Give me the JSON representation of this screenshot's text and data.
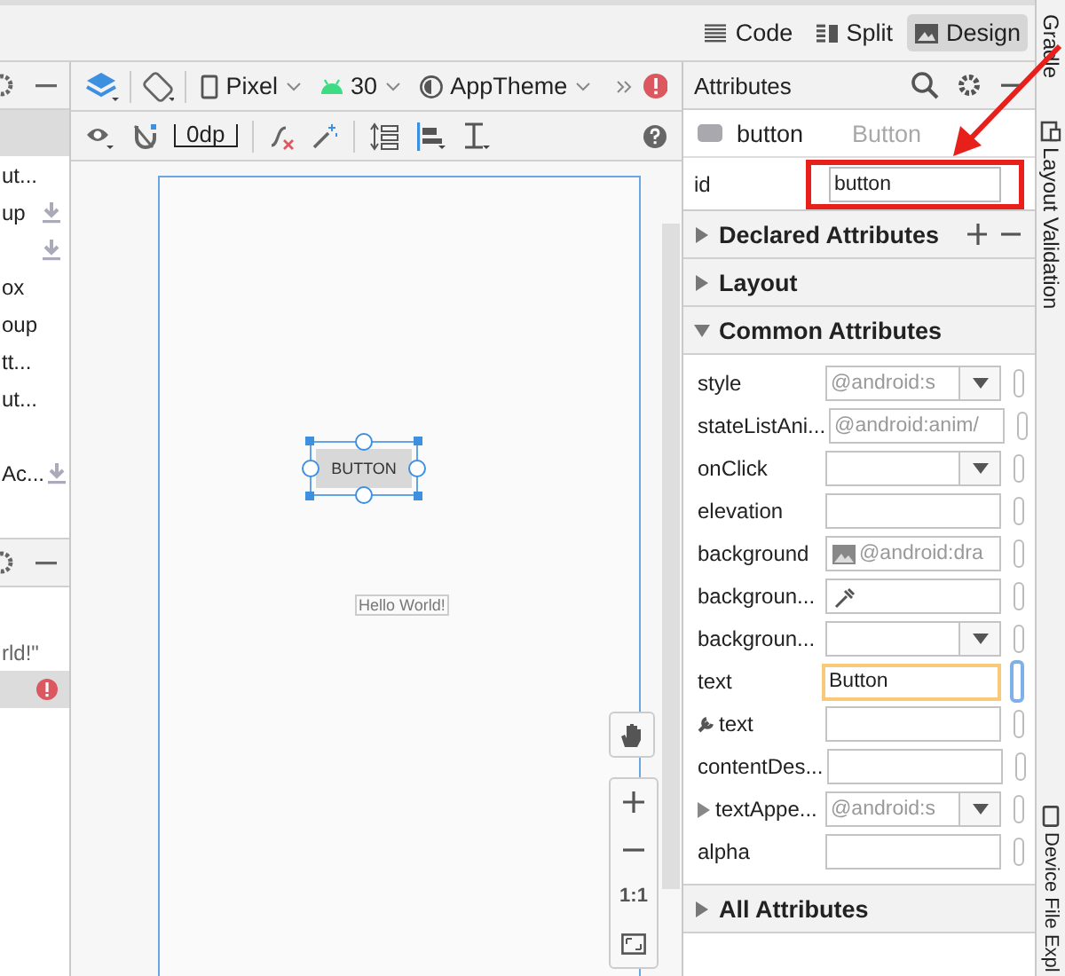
{
  "view_modes": [
    {
      "label": "Code",
      "selected": false
    },
    {
      "label": "Split",
      "selected": false
    },
    {
      "label": "Design",
      "selected": true
    }
  ],
  "palette": {
    "items": [
      {
        "label": "ut...",
        "download": false
      },
      {
        "label": "up",
        "download": true
      },
      {
        "download": true
      },
      {
        "label": "ox",
        "download": false
      },
      {
        "label": "oup",
        "download": false
      },
      {
        "label": "tt...",
        "download": false
      },
      {
        "label": "ut...",
        "download": false
      },
      {
        "download": false
      },
      {
        "label": "Ac...",
        "download": true
      }
    ]
  },
  "component_tree": {
    "items": [
      {
        "label": "rld!\"",
        "selected": false,
        "error": false
      },
      {
        "selected": true,
        "error": true
      }
    ]
  },
  "toolbar": {
    "device": "Pixel",
    "api": "30",
    "theme": "AppTheme",
    "margin": "0dp"
  },
  "canvas": {
    "widget_text": "BUTTON",
    "hello_text": "Hello World!",
    "zoom_reset": "1:1"
  },
  "attributes": {
    "title": "Attributes",
    "component": {
      "name": "button",
      "type": "Button"
    },
    "id": {
      "label": "id",
      "value": "button"
    },
    "sections_before": [
      {
        "label": "Declared Attributes",
        "expanded": false,
        "add_remove": true
      },
      {
        "label": "Layout",
        "expanded": false,
        "add_remove": false
      },
      {
        "label": "Common Attributes",
        "expanded": true,
        "add_remove": false
      }
    ],
    "properties": [
      {
        "label": "style",
        "kind": "dropdown",
        "placeholder": "@android:s",
        "focused": false,
        "tool": false,
        "expandable": false
      },
      {
        "label": "stateListAni...",
        "kind": "text",
        "placeholder": "@android:anim/",
        "focused": false,
        "tool": false,
        "expandable": false
      },
      {
        "label": "onClick",
        "kind": "dropdown",
        "focused": false,
        "tool": false,
        "expandable": false
      },
      {
        "label": "elevation",
        "kind": "text",
        "focused": false,
        "tool": false,
        "expandable": false
      },
      {
        "label": "background",
        "kind": "image",
        "placeholder": "@android:dra",
        "focused": false,
        "tool": false,
        "expandable": false
      },
      {
        "label": "backgroun...",
        "kind": "color",
        "focused": false,
        "tool": false,
        "expandable": false
      },
      {
        "label": "backgroun...",
        "kind": "dropdown",
        "focused": false,
        "tool": false,
        "expandable": false
      },
      {
        "label": "text",
        "kind": "text",
        "value": "Button",
        "focused": true,
        "tool": false,
        "expandable": false
      },
      {
        "label": "text",
        "kind": "text",
        "tool": true,
        "focused": false,
        "expandable": false
      },
      {
        "label": "contentDes...",
        "kind": "text",
        "focused": false,
        "tool": false,
        "expandable": false
      },
      {
        "label": "textAppe...",
        "kind": "dropdown",
        "expandable": true,
        "placeholder": "@android:s",
        "focused": false,
        "tool": false
      },
      {
        "label": "alpha",
        "kind": "text",
        "focused": false,
        "tool": false,
        "expandable": false
      }
    ],
    "sections_after": [
      {
        "label": "All Attributes",
        "expanded": false,
        "add_remove": false
      }
    ]
  },
  "side_tabs": [
    {
      "label": "Gradle"
    },
    {
      "label": "Layout Validation"
    },
    {
      "label": "Device File Expl"
    }
  ]
}
